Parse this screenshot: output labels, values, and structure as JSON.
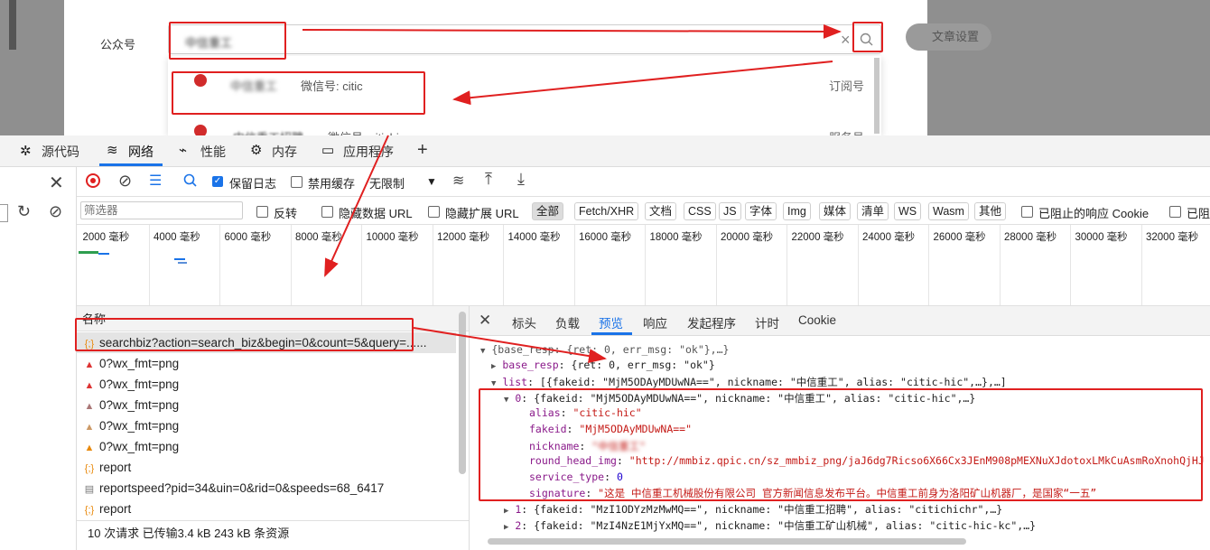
{
  "page": {
    "label_gzh": "公众号",
    "search_value": "中信重工",
    "article_settings": "文章设置",
    "dropdown": [
      {
        "name": "中信重工",
        "wx": "微信号: citic",
        "type": "订阅号"
      },
      {
        "name": "中信重工招聘",
        "wx": "微信号: citichi",
        "type": "服务号"
      }
    ]
  },
  "devtools": {
    "tabs": [
      "源代码",
      "网络",
      "性能",
      "内存",
      "应用程序",
      "+"
    ],
    "toolbar": {
      "preserve_log": "保留日志",
      "disable_cache": "禁用缓存",
      "throttle": "无限制"
    },
    "filter": {
      "placeholder": "筛选器",
      "invert": "反转",
      "hide_data_url": "隐藏数据 URL",
      "hide_ext_url": "隐藏扩展 URL",
      "chips": [
        "全部",
        "Fetch/XHR",
        "文档",
        "CSS",
        "JS",
        "字体",
        "Img",
        "媒体",
        "清单",
        "WS",
        "Wasm",
        "其他"
      ],
      "blocked_cookies": "已阻止的响应 Cookie",
      "blocked_req": "已阻"
    },
    "timeline_ticks": [
      "2000 毫秒",
      "4000 毫秒",
      "6000 毫秒",
      "8000 毫秒",
      "10000 毫秒",
      "12000 毫秒",
      "14000 毫秒",
      "16000 毫秒",
      "18000 毫秒",
      "20000 毫秒",
      "22000 毫秒",
      "24000 毫秒",
      "26000 毫秒",
      "28000 毫秒",
      "30000 毫秒",
      "32000 毫秒"
    ],
    "list_header": "名称",
    "requests": [
      {
        "icon": "{;}",
        "name": "searchbiz?action=search_biz&begin=0&count=5&query=......"
      },
      {
        "icon": "▲",
        "name": "0?wx_fmt=png"
      },
      {
        "icon": "▲",
        "name": "0?wx_fmt=png"
      },
      {
        "icon": "▲",
        "name": "0?wx_fmt=png"
      },
      {
        "icon": "▲",
        "name": "0?wx_fmt=png"
      },
      {
        "icon": "▲",
        "name": "0?wx_fmt=png"
      },
      {
        "icon": "{;}",
        "name": "report"
      },
      {
        "icon": "▤",
        "name": "reportspeed?pid=34&uin=0&rid=0&speeds=68_6417"
      },
      {
        "icon": "{;}",
        "name": "report"
      }
    ],
    "footer": "10 次请求  已传输3.4 kB  243 kB 条资源",
    "detail_tabs": [
      "标头",
      "负载",
      "预览",
      "响应",
      "发起程序",
      "计时",
      "Cookie"
    ],
    "preview": {
      "line0": "{base_resp: {ret: 0, err_msg: \"ok\"},…}",
      "base_resp_key": "base_resp",
      "base_resp_val": "{ret: 0, err_msg: \"ok\"}",
      "list_key": "list",
      "list_val": "[{fakeid: \"MjM5ODAyMDUwNA==\", nickname: \"中信重工\", alias: \"citic-hic\",…},…]",
      "item0_key": "0",
      "item0_val": "{fakeid: \"MjM5ODAyMDUwNA==\", nickname: \"中信重工\", alias: \"citic-hic\",…}",
      "alias_key": "alias",
      "alias_val": "\"citic-hic\"",
      "fakeid_key": "fakeid",
      "fakeid_val": "\"MjM5ODAyMDUwNA==\"",
      "nickname_key": "nickname",
      "nickname_val": "\"中信重工\"",
      "head_key": "round_head_img",
      "head_val": "\"http://mmbiz.qpic.cn/sz_mmbiz_png/jaJ6dg7Ricso6X66Cx3JEnM908pMEXNuXJdotoxLMkCuAsmRoXnohQjHJ",
      "stype_key": "service_type",
      "stype_val": "0",
      "sig_key": "signature",
      "sig_val": "\"这是 中信重工机械股份有限公司 官方新闻信息发布平台。中信重工前身为洛阳矿山机器厂，是国家“一五”",
      "item1_key": "1",
      "item1_val": "{fakeid: \"MzI1ODYzMzMwMQ==\", nickname: \"中信重工招聘\", alias: \"citichichr\",…}",
      "item2_key": "2",
      "item2_val": "{fakeid: \"MzI4NzE1MjYxMQ==\", nickname: \"中信重工矿山机械\", alias: \"citic-hic-kc\",…}"
    }
  },
  "colors": {
    "accent": "#1a73e8",
    "annotation": "#e02020",
    "key": "#8a1a8a",
    "string": "#c41a16"
  }
}
